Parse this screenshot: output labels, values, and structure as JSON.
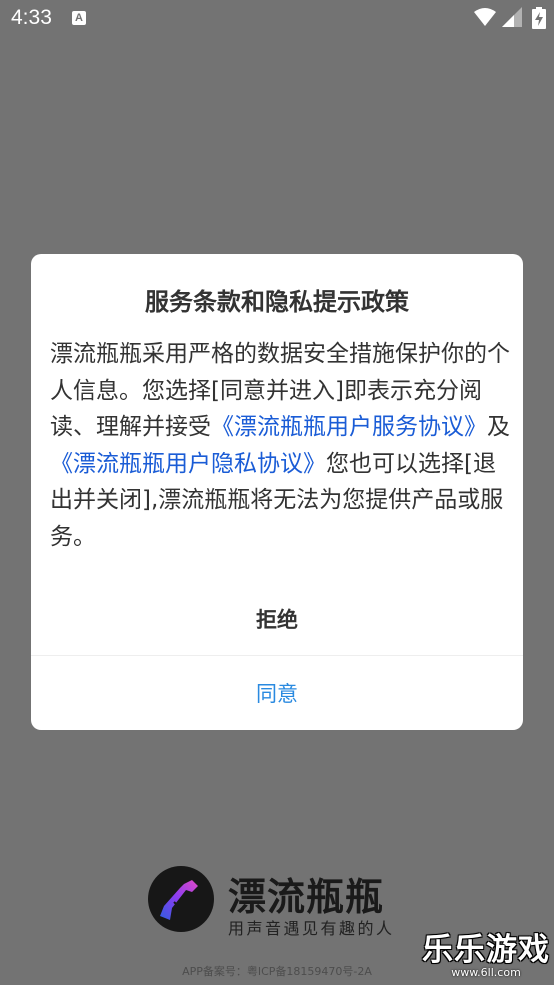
{
  "status_bar": {
    "time": "4:33",
    "notification_icon_letter": "A",
    "icons": [
      "wifi-icon",
      "signal-icon",
      "battery-charging-icon"
    ]
  },
  "dialog": {
    "title": "服务条款和隐私提示政策",
    "body_part1": "漂流瓶瓶采用严格的数据安全措施保护你的个人信息。您选择[同意并进入]即表示充分阅读、理解并接受",
    "link_user_agreement": "《漂流瓶瓶用户服务协议》",
    "body_part2": "及",
    "link_privacy_policy": "《漂流瓶瓶用户隐私协议》",
    "body_part3": "您也可以选择[退出并关闭],漂流瓶瓶将无法为您提供产品或服务。",
    "reject_label": "拒绝",
    "agree_label": "同意"
  },
  "branding": {
    "app_name": "漂流瓶瓶",
    "slogan": "用声音遇见有趣的人",
    "icp": "APP备案号：粤ICP备18159470号-2A"
  },
  "watermark": {
    "main": "乐乐游戏",
    "url": "www.6ll.com"
  },
  "colors": {
    "overlay": "#737373",
    "link": "#1a5cd6",
    "agree": "#2a8ae0"
  }
}
